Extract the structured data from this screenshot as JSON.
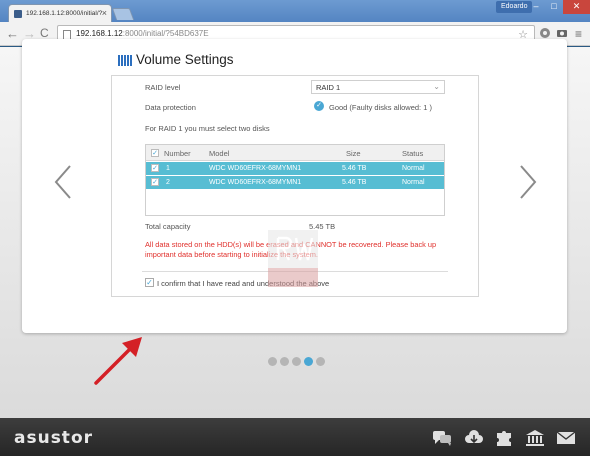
{
  "browser": {
    "tab_title": "192.168.1.12:8000/initial/?",
    "tab_close": "×",
    "user": "Edoardo",
    "win_min": "–",
    "win_max": "□",
    "win_close": "✕",
    "url_host": "192.168.1.12",
    "url_path": ":8000/initial/?54BD637E",
    "back": "←",
    "forward": "→",
    "reload": "C",
    "star": "☆",
    "menu": "≡"
  },
  "page": {
    "title": "Volume Settings",
    "raid_level_label": "RAID level",
    "raid_level_value": "RAID 1",
    "data_protection_label": "Data protection",
    "data_protection_value": "Good (Faulty disks allowed: 1 )",
    "instruction": "For RAID 1 you must select two disks",
    "table": {
      "headers": [
        "Number",
        "Model",
        "Size",
        "Status"
      ],
      "rows": [
        {
          "number": "1",
          "model": "WDC WD60EFRX-68MYMN1",
          "size": "5.46 TB",
          "status": "Normal"
        },
        {
          "number": "2",
          "model": "WDC WD60EFRX-68MYMN1",
          "size": "5.46 TB",
          "status": "Normal"
        }
      ]
    },
    "total_capacity_label": "Total capacity",
    "total_capacity_value": "5.45 TB",
    "warning": "All data stored on the HDD(s) will be erased and CANNOT be recovered. Please back up important data before starting to initialize the system.",
    "confirm_label": "I confirm that I have read and understood the above",
    "step_count": 5,
    "active_step": 4
  },
  "footer": {
    "logo": "asustor"
  },
  "colors": {
    "accent": "#4aa7d4",
    "row_highlight": "#57bdd3",
    "warning": "#e0302c",
    "annotation_arrow": "#d42026"
  }
}
